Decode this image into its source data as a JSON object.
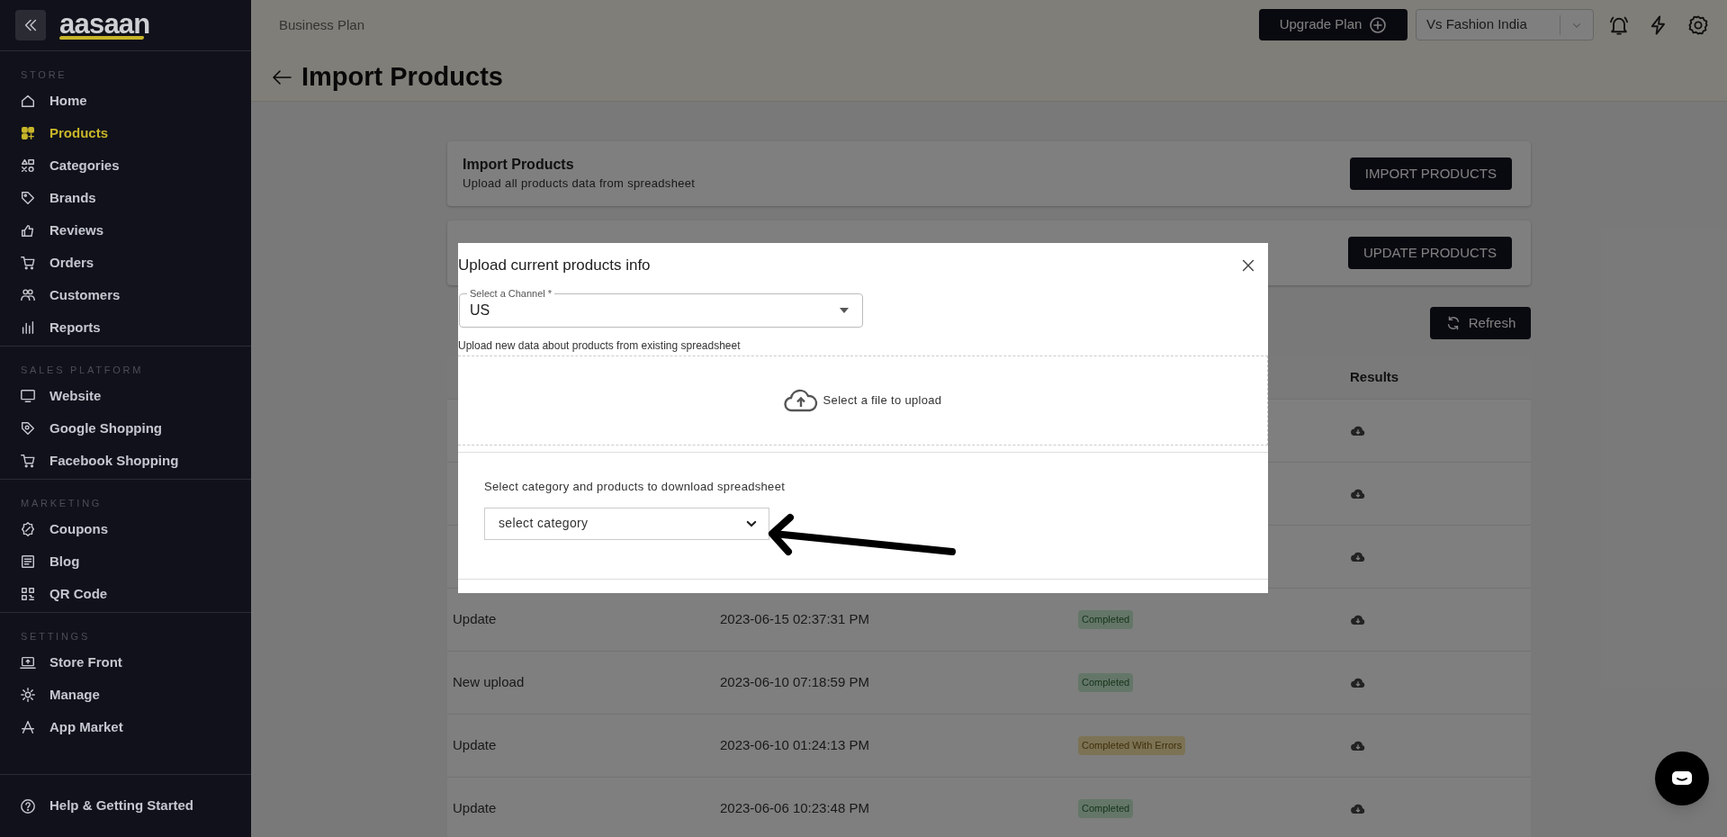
{
  "sidebar": {
    "logo": "aasaan",
    "sections": [
      {
        "title": "STORE",
        "items": [
          {
            "label": "Home",
            "selected": false
          },
          {
            "label": "Products",
            "selected": true
          },
          {
            "label": "Categories",
            "selected": false
          },
          {
            "label": "Brands",
            "selected": false
          },
          {
            "label": "Reviews",
            "selected": false
          },
          {
            "label": "Orders",
            "selected": false
          },
          {
            "label": "Customers",
            "selected": false
          },
          {
            "label": "Reports",
            "selected": false
          }
        ]
      },
      {
        "title": "SALES PLATFORM",
        "items": [
          {
            "label": "Website",
            "selected": false
          },
          {
            "label": "Google Shopping",
            "selected": false
          },
          {
            "label": "Facebook Shopping",
            "selected": false
          }
        ]
      },
      {
        "title": "MARKETING",
        "items": [
          {
            "label": "Coupons",
            "selected": false
          },
          {
            "label": "Blog",
            "selected": false
          },
          {
            "label": "QR Code",
            "selected": false
          }
        ]
      },
      {
        "title": "SETTINGS",
        "items": [
          {
            "label": "Store Front",
            "selected": false
          },
          {
            "label": "Manage",
            "selected": false
          },
          {
            "label": "App Market",
            "selected": false
          }
        ]
      }
    ],
    "footer_item": "Help & Getting Started"
  },
  "header": {
    "plan": "Business Plan",
    "upgrade_button": "Upgrade Plan",
    "store_select": "Vs Fashion India",
    "page_title": "Import Products"
  },
  "cards": [
    {
      "title": "Import Products",
      "subtitle": "Upload all products data from spreadsheet",
      "button": "IMPORT PRODUCTS"
    },
    {
      "button": "UPDATE PRODUCTS"
    }
  ],
  "refresh_button": "Refresh",
  "table": {
    "results_header": "Results",
    "rows": [
      {},
      {},
      {},
      {
        "type": "Update",
        "date": "2023-06-15 02:37:31 PM",
        "status": {
          "label": "Completed",
          "kind": "success"
        }
      },
      {
        "type": "New upload",
        "date": "2023-06-10 07:18:59 PM",
        "status": {
          "label": "Completed",
          "kind": "success"
        }
      },
      {
        "type": "Update",
        "date": "2023-06-10 01:24:13 PM",
        "status": {
          "label": "Completed With Errors",
          "kind": "warning"
        }
      },
      {
        "type": "Update",
        "date": "2023-06-06 10:23:48 PM",
        "status": {
          "label": "Completed",
          "kind": "success"
        }
      }
    ]
  },
  "modal": {
    "title": "Upload current products info",
    "channel_label": "Select a Channel *",
    "channel_value": "US",
    "helper": "Upload new data about products from existing spreadsheet",
    "dropzone": "Select a file to upload",
    "category_prompt": "Select category and products to download spreadsheet",
    "category_placeholder": "select category"
  }
}
